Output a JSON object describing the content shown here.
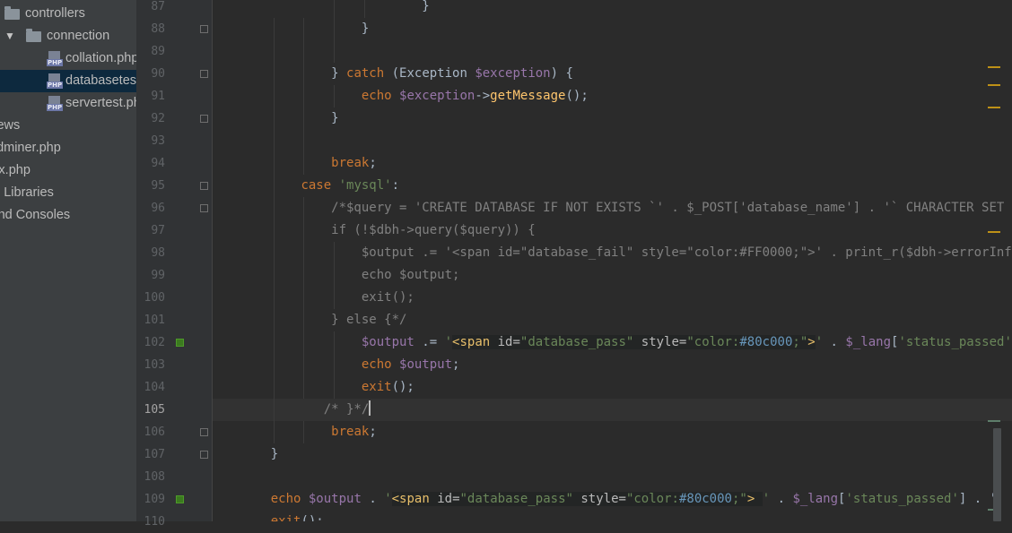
{
  "sidebar": {
    "items": [
      {
        "label": "controllers",
        "type": "folder",
        "indent": 0
      },
      {
        "label": "connection",
        "type": "folder",
        "indent": 1,
        "expanded": true
      },
      {
        "label": "collation.php",
        "type": "php",
        "indent": 2
      },
      {
        "label": "databasetest.php",
        "type": "php",
        "indent": 2,
        "selected": true
      },
      {
        "label": "servertest.php",
        "type": "php",
        "indent": 2
      },
      {
        "label": "views",
        "type": "text",
        "indent": -1
      },
      {
        "label": "adminer.php",
        "type": "text",
        "indent": -1
      },
      {
        "label": "index.php",
        "type": "text",
        "indent": -1
      },
      {
        "label": "External Libraries",
        "type": "text",
        "indent": -1
      },
      {
        "label": "Scratches and Consoles",
        "type": "text",
        "indent": -1
      }
    ],
    "php_badge": "PHP"
  },
  "editor": {
    "current_line": 105,
    "lines": [
      {
        "n": 87,
        "guides": [
          3,
          4
        ],
        "fold": false,
        "marker": false,
        "tokens": [
          {
            "t": "                        }",
            "c": "plain"
          }
        ]
      },
      {
        "n": 88,
        "guides": [
          1,
          2,
          3
        ],
        "fold": true,
        "marker": false,
        "tokens": [
          {
            "t": "                }",
            "c": "plain"
          }
        ]
      },
      {
        "n": 89,
        "guides": [
          1,
          2,
          3
        ],
        "fold": false,
        "marker": false,
        "tokens": []
      },
      {
        "n": 90,
        "guides": [
          1,
          2
        ],
        "fold": true,
        "marker": false,
        "tokens": [
          {
            "t": "            } ",
            "c": "plain"
          },
          {
            "t": "catch",
            "c": "kw"
          },
          {
            "t": " (Exception ",
            "c": "plain"
          },
          {
            "t": "$exception",
            "c": "var"
          },
          {
            "t": ") {",
            "c": "plain"
          }
        ]
      },
      {
        "n": 91,
        "guides": [
          1,
          2,
          3
        ],
        "fold": false,
        "marker": false,
        "tokens": [
          {
            "t": "                ",
            "c": "plain"
          },
          {
            "t": "echo",
            "c": "kw"
          },
          {
            "t": " ",
            "c": "plain"
          },
          {
            "t": "$exception",
            "c": "var"
          },
          {
            "t": "->",
            "c": "plain"
          },
          {
            "t": "getMessage",
            "c": "fn"
          },
          {
            "t": "();",
            "c": "plain"
          }
        ]
      },
      {
        "n": 92,
        "guides": [
          1,
          2
        ],
        "fold": true,
        "marker": false,
        "tokens": [
          {
            "t": "            }",
            "c": "plain"
          }
        ]
      },
      {
        "n": 93,
        "guides": [
          1,
          2
        ],
        "fold": false,
        "marker": false,
        "tokens": []
      },
      {
        "n": 94,
        "guides": [
          1,
          2
        ],
        "fold": false,
        "marker": false,
        "tokens": [
          {
            "t": "            ",
            "c": "plain"
          },
          {
            "t": "break",
            "c": "kw"
          },
          {
            "t": ";",
            "c": "plain"
          }
        ]
      },
      {
        "n": 95,
        "guides": [
          1
        ],
        "fold": true,
        "marker": false,
        "tokens": [
          {
            "t": "        ",
            "c": "plain"
          },
          {
            "t": "case",
            "c": "kw"
          },
          {
            "t": " ",
            "c": "plain"
          },
          {
            "t": "'mysql'",
            "c": "str"
          },
          {
            "t": ":",
            "c": "plain"
          }
        ]
      },
      {
        "n": 96,
        "guides": [
          1,
          2
        ],
        "fold": true,
        "marker": false,
        "tokens": [
          {
            "t": "            /*$query = 'CREATE DATABASE IF NOT EXISTS `' . $_POST['database_name'] . '` CHARACTER SET",
            "c": "cm"
          }
        ]
      },
      {
        "n": 97,
        "guides": [
          1,
          2
        ],
        "fold": false,
        "marker": false,
        "tokens": [
          {
            "t": "            if (!$dbh->query($query)) {",
            "c": "cm"
          }
        ]
      },
      {
        "n": 98,
        "guides": [
          1,
          2,
          3
        ],
        "fold": false,
        "marker": false,
        "tokens": [
          {
            "t": "                $output .= '<span id=\"database_fail\" style=\"color:#FF0000;\">' . print_r($dbh->errorInfo",
            "c": "cm"
          }
        ]
      },
      {
        "n": 99,
        "guides": [
          1,
          2,
          3
        ],
        "fold": false,
        "marker": false,
        "tokens": [
          {
            "t": "                echo $output;",
            "c": "cm"
          }
        ]
      },
      {
        "n": 100,
        "guides": [
          1,
          2,
          3
        ],
        "fold": false,
        "marker": false,
        "tokens": [
          {
            "t": "                exit();",
            "c": "cm"
          }
        ]
      },
      {
        "n": 101,
        "guides": [
          1,
          2
        ],
        "fold": false,
        "marker": false,
        "tokens": [
          {
            "t": "            } else {*/",
            "c": "cm"
          }
        ]
      },
      {
        "n": 102,
        "guides": [
          1,
          2,
          3
        ],
        "fold": false,
        "marker": true,
        "tokens": [
          {
            "t": "                ",
            "c": "plain"
          },
          {
            "t": "$output",
            "c": "var"
          },
          {
            "t": " .= ",
            "c": "plain"
          },
          {
            "t": "'",
            "c": "str"
          },
          {
            "t": "<span",
            "c": "tag",
            "e": true
          },
          {
            "t": " id=",
            "c": "attr",
            "e": true
          },
          {
            "t": "\"database_pass\"",
            "c": "str",
            "e": true
          },
          {
            "t": " style=",
            "c": "attr",
            "e": true
          },
          {
            "t": "\"color:",
            "c": "str",
            "e": true
          },
          {
            "t": "#80c000",
            "c": "hex",
            "e": true
          },
          {
            "t": ";\"",
            "c": "str",
            "e": true
          },
          {
            "t": ">",
            "c": "tag",
            "e": true
          },
          {
            "t": "'",
            "c": "str"
          },
          {
            "t": " . ",
            "c": "plain"
          },
          {
            "t": "$_lang",
            "c": "var"
          },
          {
            "t": "[",
            "c": "plain"
          },
          {
            "t": "'status_passed'",
            "c": "str"
          },
          {
            "t": "]",
            "c": "plain"
          }
        ]
      },
      {
        "n": 103,
        "guides": [
          1,
          2,
          3
        ],
        "fold": false,
        "marker": false,
        "tokens": [
          {
            "t": "                ",
            "c": "plain"
          },
          {
            "t": "echo",
            "c": "kw"
          },
          {
            "t": " ",
            "c": "plain"
          },
          {
            "t": "$output",
            "c": "var"
          },
          {
            "t": ";",
            "c": "plain"
          }
        ]
      },
      {
        "n": 104,
        "guides": [
          1,
          2,
          3
        ],
        "fold": false,
        "marker": false,
        "tokens": [
          {
            "t": "                ",
            "c": "plain"
          },
          {
            "t": "exit",
            "c": "kw"
          },
          {
            "t": "();",
            "c": "plain"
          }
        ]
      },
      {
        "n": 105,
        "guides": [
          1
        ],
        "fold": false,
        "marker": false,
        "caret": true,
        "tokens": [
          {
            "t": "           /* }*/",
            "c": "cm"
          }
        ]
      },
      {
        "n": 106,
        "guides": [
          1,
          2
        ],
        "fold": true,
        "marker": false,
        "tokens": [
          {
            "t": "            ",
            "c": "plain"
          },
          {
            "t": "break",
            "c": "kw"
          },
          {
            "t": ";",
            "c": "plain"
          }
        ]
      },
      {
        "n": 107,
        "guides": [],
        "fold": true,
        "marker": false,
        "tokens": [
          {
            "t": "    }",
            "c": "plain"
          }
        ]
      },
      {
        "n": 108,
        "guides": [],
        "fold": false,
        "marker": false,
        "tokens": []
      },
      {
        "n": 109,
        "guides": [],
        "fold": false,
        "marker": true,
        "tokens": [
          {
            "t": "    ",
            "c": "plain"
          },
          {
            "t": "echo",
            "c": "kw"
          },
          {
            "t": " ",
            "c": "plain"
          },
          {
            "t": "$output",
            "c": "var"
          },
          {
            "t": " . ",
            "c": "plain"
          },
          {
            "t": "'",
            "c": "str"
          },
          {
            "t": "<span",
            "c": "tag",
            "e": true
          },
          {
            "t": " id=",
            "c": "attr",
            "e": true
          },
          {
            "t": "\"database_pass\"",
            "c": "str",
            "e": true
          },
          {
            "t": " style=",
            "c": "attr",
            "e": true
          },
          {
            "t": "\"color:",
            "c": "str",
            "e": true
          },
          {
            "t": "#80c000",
            "c": "hex",
            "e": true
          },
          {
            "t": ";\"",
            "c": "str",
            "e": true
          },
          {
            "t": ">",
            "c": "tag",
            "e": true
          },
          {
            "t": " ",
            "c": "plain",
            "e": true
          },
          {
            "t": "'",
            "c": "str"
          },
          {
            "t": " . ",
            "c": "plain"
          },
          {
            "t": "$_lang",
            "c": "var"
          },
          {
            "t": "[",
            "c": "plain"
          },
          {
            "t": "'status_passed'",
            "c": "str"
          },
          {
            "t": "]",
            "c": "plain"
          },
          {
            "t": " . '",
            "c": "plain"
          }
        ]
      },
      {
        "n": 110,
        "guides": [],
        "fold": false,
        "marker": false,
        "tokens": [
          {
            "t": "    ",
            "c": "plain"
          },
          {
            "t": "exit",
            "c": "kw"
          },
          {
            "t": "();",
            "c": "plain"
          }
        ]
      }
    ]
  },
  "colors": {
    "background": "#2b2b2b",
    "gutter": "#313335",
    "sidebar": "#3c3f41",
    "selection": "#0d293e",
    "warning_mark": "#be9117",
    "vcs_added": "#4e9a2a",
    "scroll_mark_green": "#5e7e6b"
  }
}
